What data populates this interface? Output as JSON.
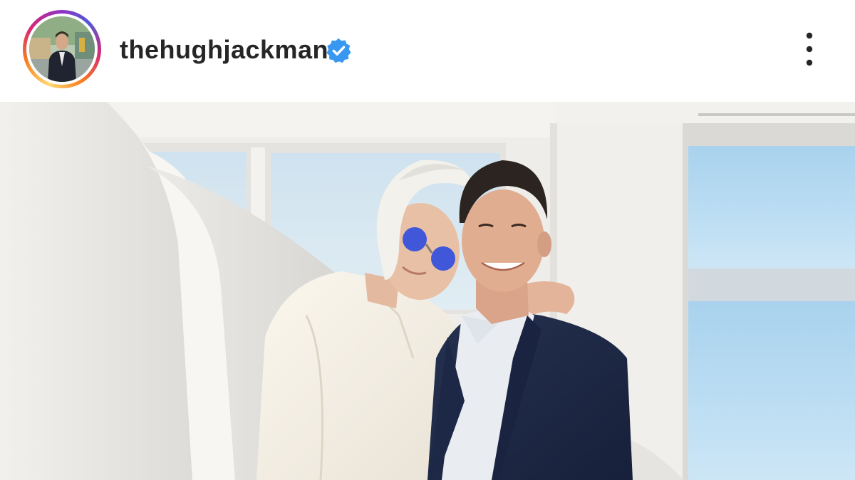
{
  "post": {
    "username": "thehughjackman",
    "verified": true,
    "avatar_icon": "profile-photo",
    "verified_icon": "verified-badge-icon",
    "more_icon": "more-options-icon"
  },
  "colors": {
    "verified_blue": "#3897f0",
    "username_text": "#262626",
    "story_ring": [
      "#feda75",
      "#fa7e1e",
      "#d62976",
      "#962fbf",
      "#4f5bd5"
    ]
  }
}
